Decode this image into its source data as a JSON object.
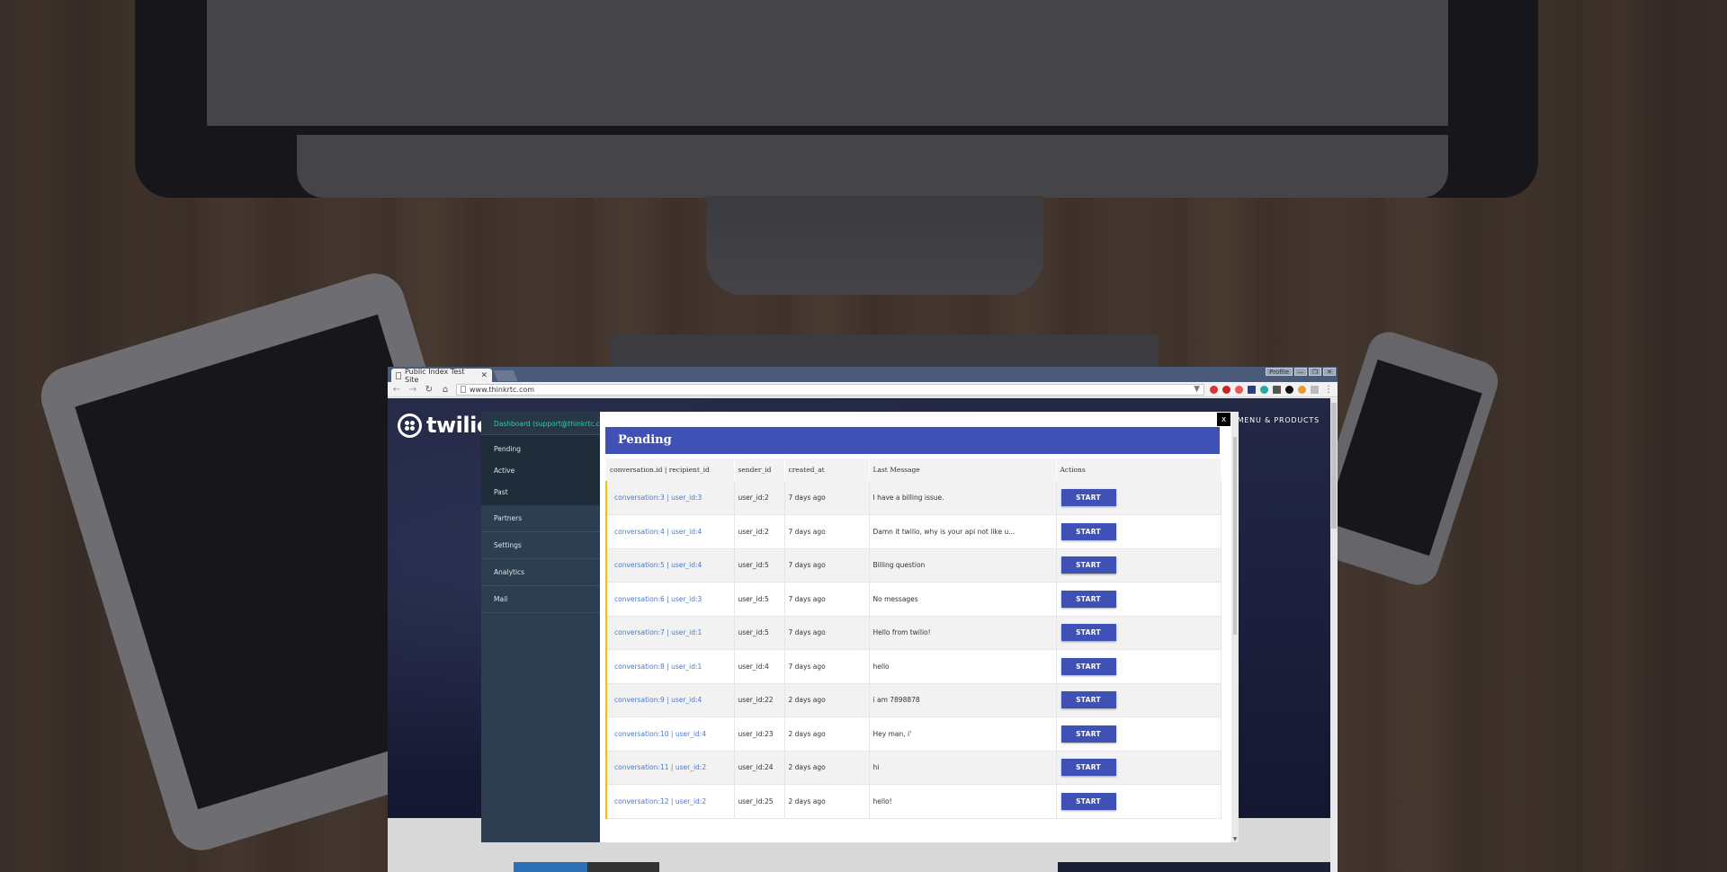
{
  "browser": {
    "tab_title": "Public Index Test Site",
    "tab_close": "✕",
    "url": "www.thinkrtc.com",
    "window_controls": [
      "—",
      "❐",
      "✕"
    ],
    "profile_label": "Profile",
    "extension_colors": [
      "#d33",
      "#c22",
      "#e55",
      "#c44",
      "#e77",
      "#d33",
      "#2aa",
      "#111",
      "#555",
      "#e89a2a",
      "#999"
    ]
  },
  "site": {
    "logo_text": "twilio",
    "menu_label": "MENU & PRODUCTS"
  },
  "dashboard": {
    "header": "Dashboard (support@thinkrtc.com)",
    "sub_items": [
      "Pending",
      "Active",
      "Past"
    ],
    "main_items": [
      "Partners",
      "Settings",
      "Analytics",
      "Mail"
    ],
    "close_label": "x",
    "panel_title": "Pending",
    "columns": [
      "conversation.id | recipient_id",
      "sender_id",
      "created_at",
      "Last Message",
      "Actions"
    ],
    "rows": [
      {
        "conv": "conversation:3 | user_id:3",
        "sender": "user_id:2",
        "created": "7 days ago",
        "message": "I have a billing issue.",
        "action": "START"
      },
      {
        "conv": "conversation:4 | user_id:4",
        "sender": "user_id:2",
        "created": "7 days ago",
        "message": "Damn it twilio, why is your api not like u...",
        "action": "START"
      },
      {
        "conv": "conversation:5 | user_id:4",
        "sender": "user_id:5",
        "created": "7 days ago",
        "message": "Billing question",
        "action": "START"
      },
      {
        "conv": "conversation:6 | user_id:3",
        "sender": "user_id:5",
        "created": "7 days ago",
        "message": "No messages",
        "action": "START"
      },
      {
        "conv": "conversation:7 | user_id:1",
        "sender": "user_id:5",
        "created": "7 days ago",
        "message": "Hello from twilio!",
        "action": "START"
      },
      {
        "conv": "conversation:8 | user_id:1",
        "sender": "user_id:4",
        "created": "7 days ago",
        "message": "hello",
        "action": "START"
      },
      {
        "conv": "conversation:9 | user_id:4",
        "sender": "user_id:22",
        "created": "2 days ago",
        "message": "i am 7898878",
        "action": "START"
      },
      {
        "conv": "conversation:10 | user_id:4",
        "sender": "user_id:23",
        "created": "2 days ago",
        "message": "Hey man, i'",
        "action": "START"
      },
      {
        "conv": "conversation:11 | user_id:2",
        "sender": "user_id:24",
        "created": "2 days ago",
        "message": "hi",
        "action": "START"
      },
      {
        "conv": "conversation:12 | user_id:2",
        "sender": "user_id:25",
        "created": "2 days ago",
        "message": "hello!",
        "action": "START"
      }
    ]
  },
  "colors": {
    "panel_header": "#3f51b5",
    "start_button": "#3f51b5",
    "sidebar_bg": "#2c3e50",
    "sidebar_header_text": "#2bd1a8",
    "row_accent": "#f2c200",
    "conversation_link": "#4a7ac7"
  }
}
